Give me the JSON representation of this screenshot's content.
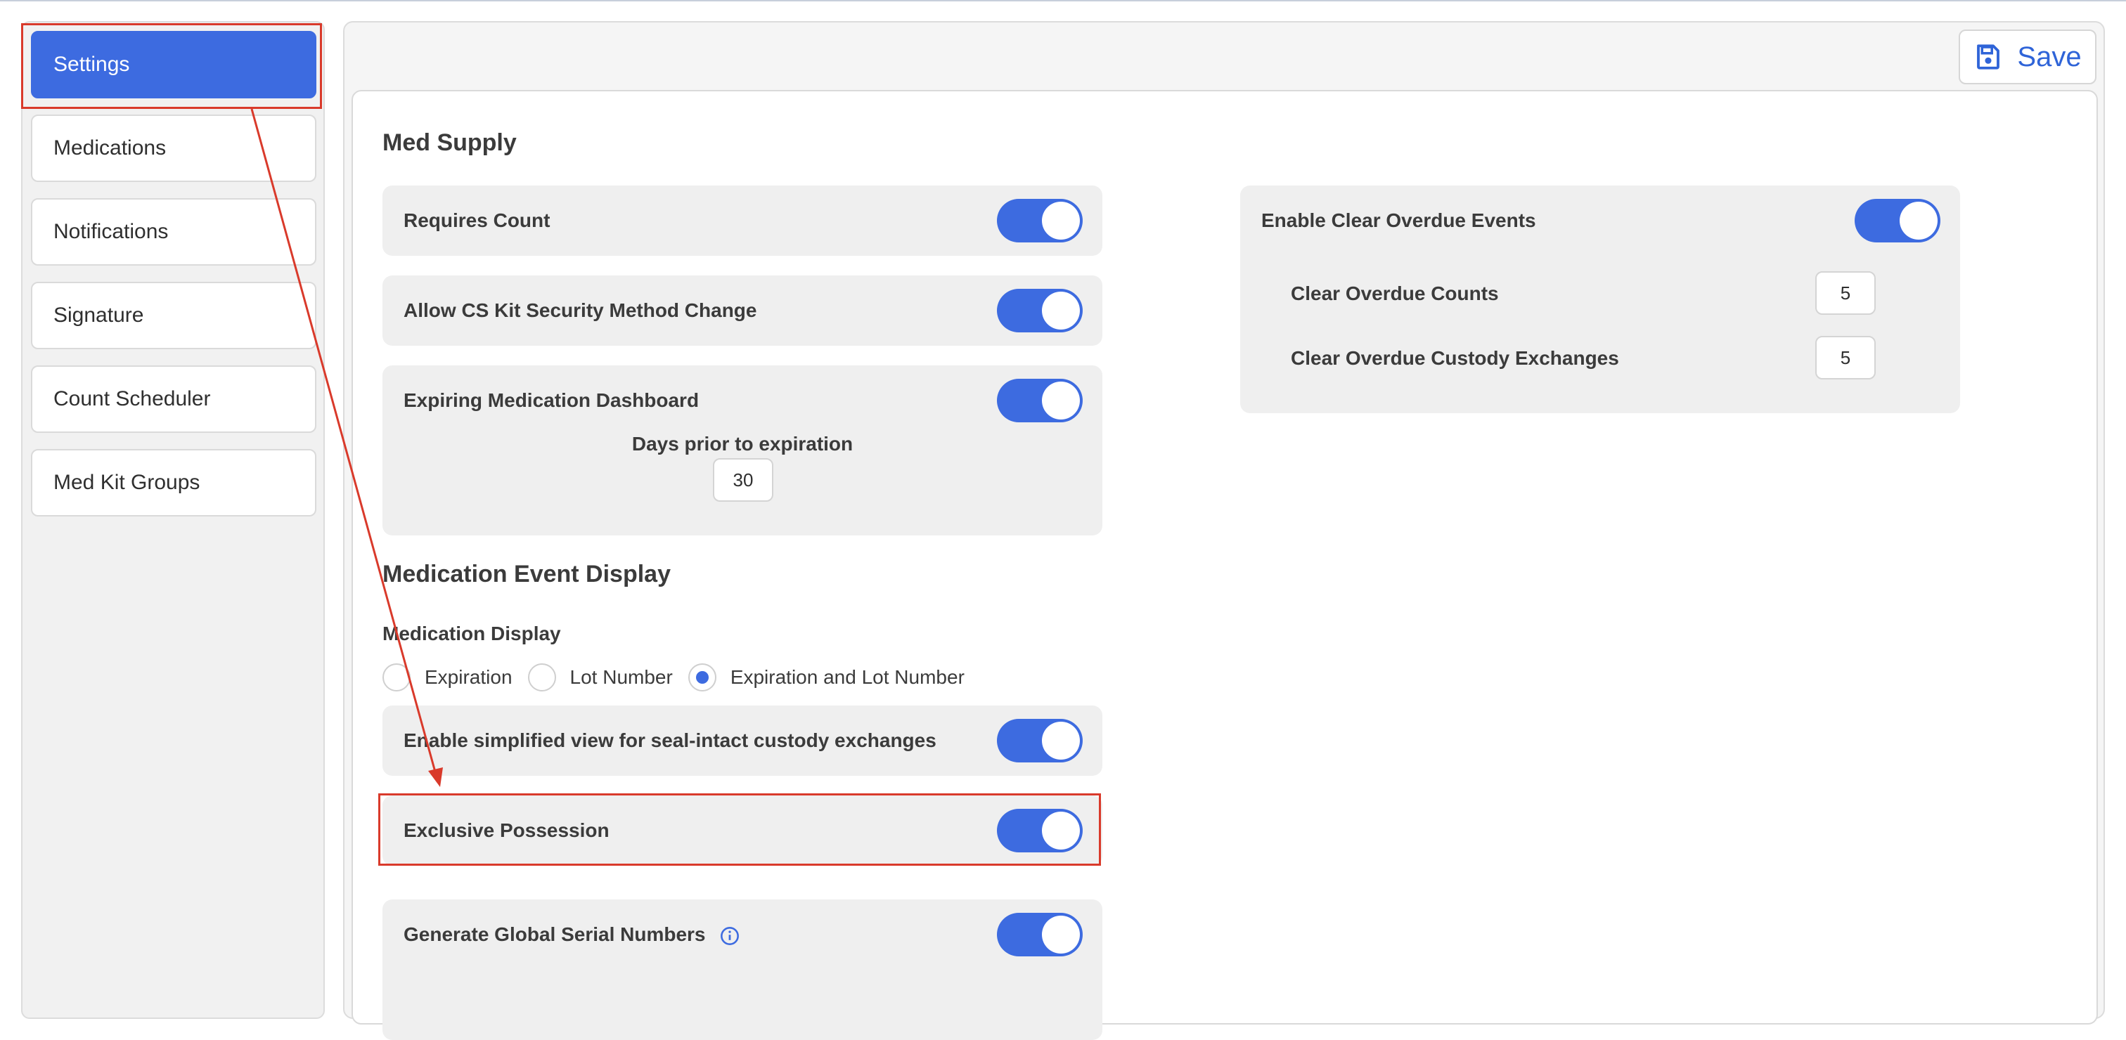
{
  "sidebar": {
    "items": [
      {
        "label": "Settings",
        "active": true
      },
      {
        "label": "Medications",
        "active": false
      },
      {
        "label": "Notifications",
        "active": false
      },
      {
        "label": "Signature",
        "active": false
      },
      {
        "label": "Count Scheduler",
        "active": false
      },
      {
        "label": "Med Kit Groups",
        "active": false
      }
    ]
  },
  "toolbar": {
    "save_label": "Save",
    "save_icon": "floppy-disk-icon"
  },
  "med_supply": {
    "title": "Med Supply",
    "requires_count": {
      "label": "Requires Count",
      "on": true
    },
    "allow_cs_kit": {
      "label": "Allow CS Kit Security Method Change",
      "on": true
    },
    "expiring_dashboard": {
      "label": "Expiring Medication Dashboard",
      "on": true,
      "days_label": "Days prior to expiration",
      "days_value": "30"
    },
    "clear_overdue": {
      "label": "Enable Clear Overdue Events",
      "on": true,
      "counts_label": "Clear Overdue Counts",
      "counts_value": "5",
      "custody_label": "Clear Overdue Custody Exchanges",
      "custody_value": "5"
    }
  },
  "event_display": {
    "title": "Medication Event Display",
    "medication_display_label": "Medication Display",
    "options": [
      {
        "label": "Expiration",
        "selected": false
      },
      {
        "label": "Lot Number",
        "selected": false
      },
      {
        "label": "Expiration and Lot Number",
        "selected": true
      }
    ],
    "simplified_view": {
      "label": "Enable simplified view for seal-intact custody exchanges",
      "on": true
    },
    "exclusive_possession": {
      "label": "Exclusive Possession",
      "on": true
    },
    "global_serial": {
      "label": "Generate Global Serial Numbers",
      "on": true,
      "icon": "info-icon"
    }
  },
  "colors": {
    "accent": "#3d6be0",
    "annotation": "#d93a2b"
  }
}
